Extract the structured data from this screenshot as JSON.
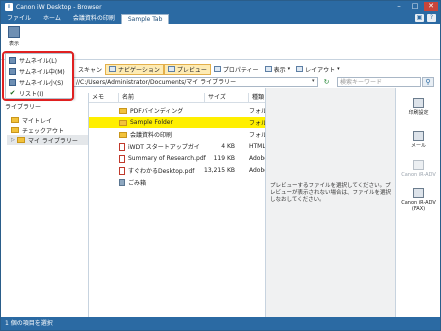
{
  "window": {
    "title": "Canon iW Desktop - Browser"
  },
  "menu": {
    "tabs": [
      "ファイル",
      "ホーム",
      "会議資料の印刷",
      "Sample Tab"
    ],
    "active_index": 3
  },
  "ribbon": {
    "view_label": "表示"
  },
  "view_menu": {
    "items": [
      {
        "label": "サムネイル(L)",
        "checked": false
      },
      {
        "label": "サムネイル中(M)",
        "checked": false
      },
      {
        "label": "サムネイル小(S)",
        "checked": false
      },
      {
        "label": "リスト(I)",
        "checked": true
      }
    ]
  },
  "toolbar": {
    "scan": "スキャン",
    "navigation": "ナビゲーション",
    "preview": "プレビュー",
    "properties": "プロパティー",
    "display": "表示",
    "layout": "レイアウト"
  },
  "address": {
    "path": "//C:/Users/Administrator/Documents/マイ ライブラリー",
    "search_placeholder": "検索キーワード"
  },
  "sidebar": {
    "title": "ライブラリー",
    "items": [
      "マイトレイ",
      "チェックアウト",
      "マイ ライブラリー"
    ]
  },
  "list": {
    "headers": [
      "メモ",
      "名前",
      "サイズ",
      "種類"
    ],
    "rows": [
      {
        "name": "PDFバインディング",
        "size": "",
        "kind": "フォル",
        "icon": "folder-icon",
        "selected": false
      },
      {
        "name": "Sample Folder",
        "size": "",
        "kind": "フォル",
        "icon": "folder-icon",
        "selected": true
      },
      {
        "name": "会議資料の印刷",
        "size": "",
        "kind": "フォル",
        "icon": "folder-icon",
        "selected": false
      },
      {
        "name": "iWDT スタートアップガイ",
        "size": "4 KB",
        "kind": "HTML",
        "icon": "pdf-icon",
        "selected": false
      },
      {
        "name": "Summary of Research.pdf",
        "size": "119 KB",
        "kind": "Adobe",
        "icon": "pdf-icon",
        "selected": false
      },
      {
        "name": "すぐわかるDesktop.pdf",
        "size": "13,215 KB",
        "kind": "Adobe",
        "icon": "pdf-icon",
        "selected": false
      },
      {
        "name": "ごみ箱",
        "size": "",
        "kind": "",
        "icon": "trash-icon",
        "selected": false
      }
    ]
  },
  "preview": {
    "message": "プレビューするファイルを選択してください。プレビューが表示されない場合は、ファイルを選択しなおしてください。"
  },
  "rightbar": {
    "buttons": [
      {
        "label": "印刷設定",
        "disabled": false
      },
      {
        "label": "メール",
        "disabled": false
      },
      {
        "label": "Canon iR-ADV",
        "disabled": true
      },
      {
        "label": "Canon iR-ADV (FAX)",
        "disabled": false
      }
    ]
  },
  "status": {
    "text": "1 個の項目を選択"
  }
}
